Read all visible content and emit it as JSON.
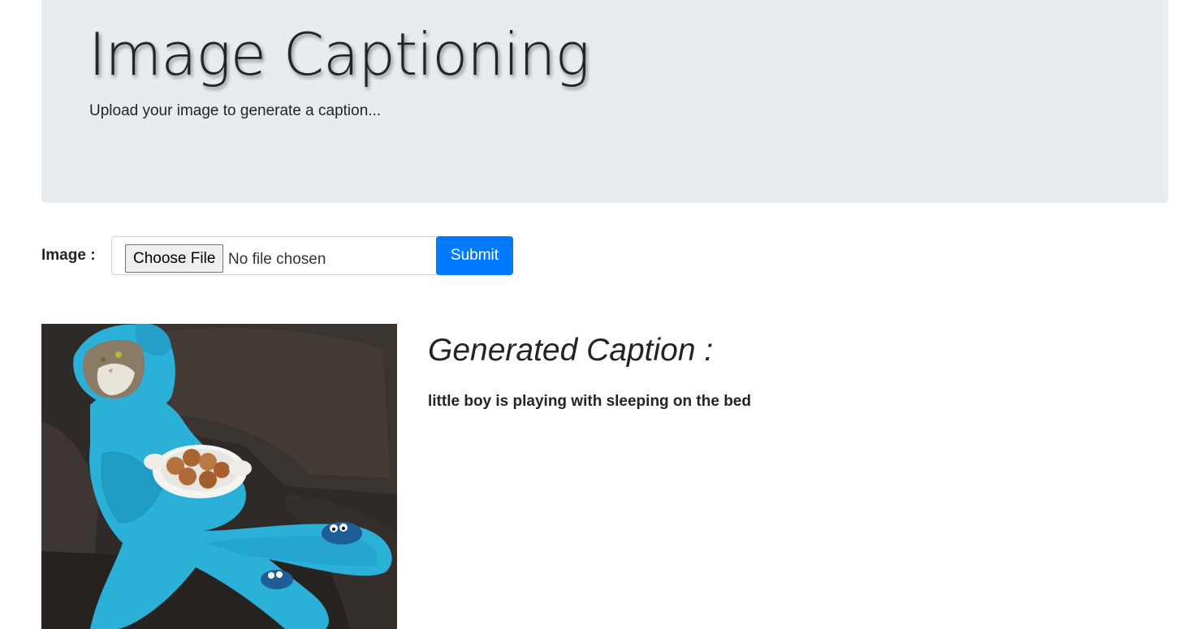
{
  "header": {
    "title": "Image Captioning",
    "subtitle": "Upload your image to generate a caption..."
  },
  "form": {
    "image_label": "Image :",
    "choose_file_label": "Choose File",
    "no_file_text": "No file chosen",
    "submit_label": "Submit"
  },
  "result": {
    "heading": "Generated Caption :",
    "caption": "little boy is playing with sleeping on the bed"
  },
  "colors": {
    "jumbotron_bg": "#e9ecef",
    "primary": "#007bff",
    "text": "#212529"
  }
}
